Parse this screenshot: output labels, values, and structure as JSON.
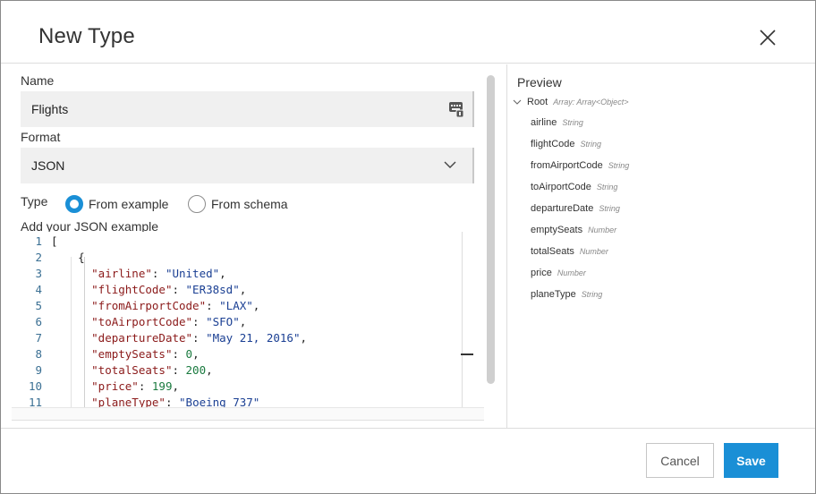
{
  "dialog": {
    "title": "New Type"
  },
  "form": {
    "name_label": "Name",
    "name_value": "Flights",
    "format_label": "Format",
    "format_value": "JSON",
    "type_label": "Type",
    "type_options": [
      {
        "label": "From example",
        "selected": true
      },
      {
        "label": "From schema",
        "selected": false
      }
    ],
    "example_label": "Add your JSON example"
  },
  "editor": {
    "lines": [
      {
        "num": "1"
      },
      {
        "num": "2"
      },
      {
        "num": "3",
        "key": "\"airline\"",
        "value": "\"United\"",
        "kind": "s"
      },
      {
        "num": "4",
        "key": "\"flightCode\"",
        "value": "\"ER38sd\"",
        "kind": "s"
      },
      {
        "num": "5",
        "key": "\"fromAirportCode\"",
        "value": "\"LAX\"",
        "kind": "s"
      },
      {
        "num": "6",
        "key": "\"toAirportCode\"",
        "value": "\"SFO\"",
        "kind": "s"
      },
      {
        "num": "7",
        "key": "\"departureDate\"",
        "value": "\"May 21, 2016\"",
        "kind": "s"
      },
      {
        "num": "8",
        "key": "\"emptySeats\"",
        "value": "0",
        "kind": "n"
      },
      {
        "num": "9",
        "key": "\"totalSeats\"",
        "value": "200",
        "kind": "n"
      },
      {
        "num": "10",
        "key": "\"price\"",
        "value": "199",
        "kind": "n"
      },
      {
        "num": "11",
        "key": "\"planeType\"",
        "value": "\"Boeing 737\"",
        "kind": "s"
      }
    ]
  },
  "preview": {
    "title": "Preview",
    "root_name": "Root",
    "root_type": "Array: Array<Object>",
    "fields": [
      {
        "name": "airline",
        "type": "String"
      },
      {
        "name": "flightCode",
        "type": "String"
      },
      {
        "name": "fromAirportCode",
        "type": "String"
      },
      {
        "name": "toAirportCode",
        "type": "String"
      },
      {
        "name": "departureDate",
        "type": "String"
      },
      {
        "name": "emptySeats",
        "type": "Number"
      },
      {
        "name": "totalSeats",
        "type": "Number"
      },
      {
        "name": "price",
        "type": "Number"
      },
      {
        "name": "planeType",
        "type": "String"
      }
    ]
  },
  "footer": {
    "cancel_label": "Cancel",
    "save_label": "Save"
  },
  "colors": {
    "accent": "#1a8fd6",
    "json_key": "#8b1a1a",
    "json_string": "#1a3f93",
    "json_number": "#1a7a3f",
    "line_number": "#3a6f93"
  },
  "icons": {
    "close": "close-icon",
    "name_field": "keyboard-icon",
    "format_dropdown": "chevron-down-icon",
    "root_toggle": "chevron-down-icon"
  }
}
